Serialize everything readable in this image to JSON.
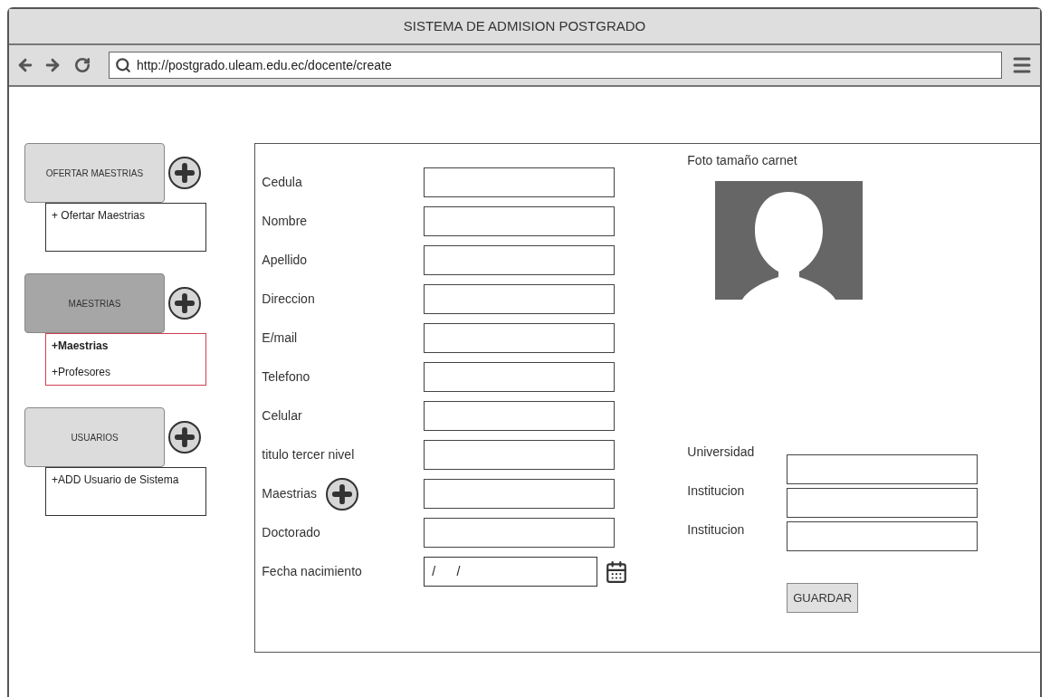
{
  "window": {
    "title": "SISTEMA DE ADMISION POSTGRADO"
  },
  "address_bar": {
    "url": "http://postgrado.uleam.edu.ec/docente/create"
  },
  "sidebar": {
    "groups": [
      {
        "label": "OFERTAR MAESTRIAS",
        "selected": false,
        "items": [
          {
            "label": "+ Ofertar Maestrias",
            "selected": false
          }
        ]
      },
      {
        "label": "MAESTRIAS",
        "selected": true,
        "items": [
          {
            "label": "+Maestrias",
            "selected": true
          },
          {
            "label": "+Profesores",
            "selected": false
          }
        ]
      },
      {
        "label": "USUARIOS",
        "selected": false,
        "items": [
          {
            "label": "+ADD Usuario de Sistema",
            "selected": false
          }
        ]
      }
    ]
  },
  "form": {
    "fields": [
      {
        "label": "Cedula",
        "kind": "text"
      },
      {
        "label": "Nombre",
        "kind": "text"
      },
      {
        "label": "Apellido",
        "kind": "text"
      },
      {
        "label": "Direccion",
        "kind": "text"
      },
      {
        "label": "E/mail",
        "kind": "text"
      },
      {
        "label": "Telefono",
        "kind": "text"
      },
      {
        "label": "Celular",
        "kind": "text"
      },
      {
        "label": "titulo tercer nivel",
        "kind": "text"
      },
      {
        "label": "Maestrias",
        "kind": "add"
      },
      {
        "label": "Doctorado",
        "kind": "text"
      },
      {
        "label": "Fecha nacimiento",
        "kind": "date",
        "value": "/      /"
      }
    ],
    "photo": {
      "label": "Foto tamaño carnet"
    },
    "studies": {
      "labels": [
        "Universidad",
        "Institucion",
        "Institucion"
      ]
    },
    "submit": "GUARDAR"
  }
}
